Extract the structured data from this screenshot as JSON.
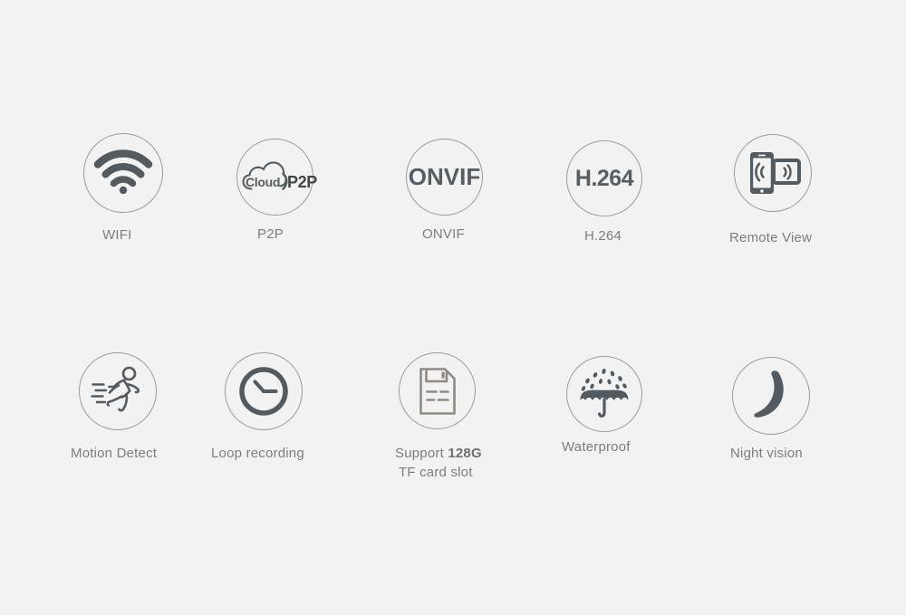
{
  "page": {
    "background_color": "#f2f2f2",
    "icon_color": "#545b60",
    "circle_stroke_color": "#9b9b9b",
    "label_color": "#7d7d7d"
  },
  "rows": [
    {
      "name": "row-1",
      "features": [
        {
          "id": "wifi",
          "label": "WIFI",
          "icon": "wifi-icon"
        },
        {
          "id": "p2p",
          "label": "P2P",
          "icon": "cloud-p2p-icon",
          "inner_text": "Cloud)P2P"
        },
        {
          "id": "onvif",
          "label": "ONVIF",
          "icon": "onvif-icon",
          "inner_text": "ONVIF"
        },
        {
          "id": "h264",
          "label": "H.264",
          "icon": "h264-icon",
          "inner_text": "H.264"
        },
        {
          "id": "remote-view",
          "label": "Remote View",
          "icon": "phone-tablet-signal-icon"
        }
      ]
    },
    {
      "name": "row-2",
      "features": [
        {
          "id": "motion-detect",
          "label": "Motion Detect",
          "icon": "running-person-icon"
        },
        {
          "id": "loop-recording",
          "label": "Loop recording",
          "icon": "clock-icon"
        },
        {
          "id": "tf-card",
          "label": "Support 128G",
          "label_strong": "128G",
          "label_prefix": "Support ",
          "label_line2": "TF card slot",
          "icon": "memory-card-icon"
        },
        {
          "id": "waterproof",
          "label": "Waterproof",
          "icon": "umbrella-rain-icon"
        },
        {
          "id": "night-vision",
          "label": "Night vision",
          "icon": "crescent-moon-icon"
        }
      ]
    }
  ]
}
